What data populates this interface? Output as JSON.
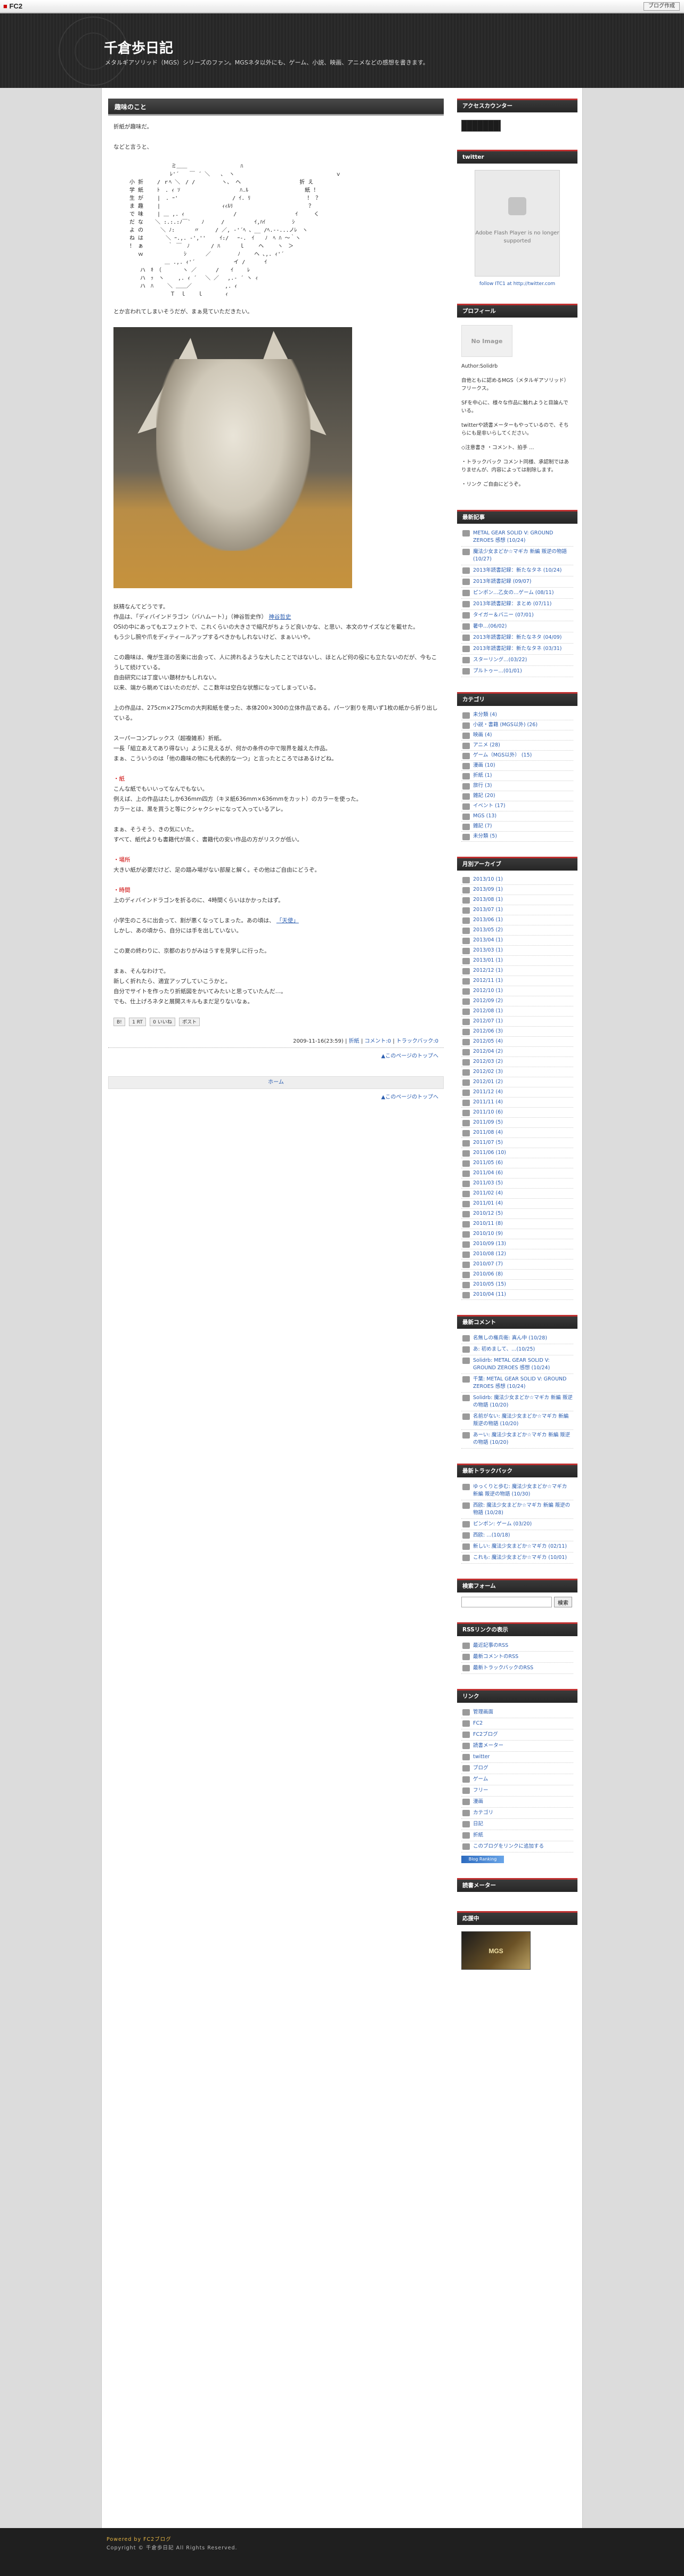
{
  "fc2bar": {
    "logo_mark": "FC2",
    "blog_button": "ブログ作成"
  },
  "header": {
    "title": "千倉歩日記",
    "description": "メタルギアソリッド（MGS）シリーズのファン。MGSネタ以外にも、ゲーム、小説、映画、アニメなどの感想を書きます。"
  },
  "entry": {
    "title": "趣味のこと",
    "p1": "折紙が趣味だ。",
    "p2": "などと言うと、",
    "aa": "                  ミ＿＿　　　　　　　　　　ﾊ\n　　　　　　　　　　 ﾚ'´　　￣ ´ ＼　　、 ヽ　　　　　　　　　　　　　　　　　　　ｖ\n　　　小 折 　　/ ｒﾍ ＼　/ /　　　　　ヽ、 ヘ　　　　　　　　　　　折 え\n　　　学 紙 　　ﾄ　. ｨ ｿ　 　　　　　　　　　 ﾊ.ﾙ　　　　　　　　　　 紙 ！\n　　　生 が 　　|　. ｰ' 　　　　　　　　　 / ｲ. ﾘ　　　　　　　　　　 ！ ？\n　　　ま 趣 　　|　　　　　　　　　　　 ｨｨﾙﾘ　 　　　　　　　　　　　　 ？\n　　　で 味 　　| ＿ ,. ｨ　　　　 　　　　 /　　　　　　　　　　　ｲ　　　く\n　　　だ な 　 ＼ :.:.:ﾉ￣`　　ﾉ 　　 /　　　　　 ｲ,ﾊｲ　　　　　ｼ\n　　　よ の 　　 ＼ ﾉ:　　　 〃　　　/ ／, -'´ﾍ 、__ /ﾍ.--...ノﾚ　ヽ\n　　　ね は 　　　 ＼ ｰ.,. -',''　　 ｲ:/　 ｰ-.　ｲ　　ﾉ　ﾍ ﾊ ～｀ヽ\n　　　！ ぁ　　　　 ｀ ￣　ﾉ　　　　/ ﾊ　　　 ｌ　　 ヘ　　 ヽ　＞\n　　　　 ｗ　　　　　　　 ｼ 　　　／　　　　　ﾉ　　 ヘ ､,. ｨ'´\n　　　　　　　　　 ＿ .,. ｨ'´ 　　　　　　 イ /　　　 ｲ\n　　　　　ハ　ｷ　（　　　　ヽ ／　　　 / 　 ｲ　　 ﾚ\n　　　　　ハ　ｯ　ヽ　　 ,. ｨ ´　 ＼ ／　 ,.- ´ ヽ ｨ\n　　　　　ハ　ﾊ　　 ＼ ＿＿／ 　　　　　 ,. ｨ\n　　　　　　　　　　 Ｔ　ｌ 　 ｌ 　　　 ｨ",
    "p3": "とか言われてしまいそうだが、まぁ見ていただきたい。",
    "p4": "妖精なんてどうです。",
    "p5": "作品は、「ディバインドラゴン（バハムート）」（神谷哲史作）",
    "p6": "OSIの中にあってもエフェクトで、これくらいの大きさで縮尺がちょうど良いかな、と思い、本文のサイズなどを載せた。",
    "p7": "もう少し腕や爪をディティールアップするべきかもしれないけど、まぁいいや。",
    "p8": "この趣味は、俺が生涯の苦楽に出会って、人に誇れるような大したことではないし、ほとんど何の役にも立たないのだが、今もこうして続けている。",
    "p9": "自由研究には丁度いい題材かもしれない。",
    "p10": "以来、端から眺めてはいたのだが、ここ数年は空白な状態になってしまっている。",
    "p11": "上の作品は、275cm×275cmの大判和紙を使った、本体200×300の立体作品である。パーツ割りを用いず1枚の紙から折り出している。",
    "p12": "スーパーコンプレックス（超複雑系）折紙。",
    "p13": "一長「組立あえてあり得ない」ように見えるが、何かの条件の中で限界を越えた作品。",
    "p14": "まぁ、こういうのは「他の趣味の物にも代表的な一つ」と言ったところではあるけどね。",
    "mark1": "・紙",
    "p15": "こんな紙でもいいってなんでもない。",
    "p16": "例えば、上の作品はたしか636mm四方（キヌ紙636mm×636mmをカット）のカラーを使った。",
    "p17": "カラーとは、黒を買うと等にクシャクシャになって入っているアレ。",
    "p18": "まぁ、そうそう、きの気にいた。",
    "p19": "すべて、紙代よりも書籍代が高く、書籍代の安い作品の方がリスクが低い。",
    "mark2": "・場所",
    "p20": "大きい紙が必要だけど、足の踏み場がない部屋と解く。その他はご自由にどうぞ。",
    "mark3": "・時間",
    "p21": "上のディバインドラゴンを折るのに、4時間くらいはかかったはず。",
    "p22": "小学生のころに出会って、割が悪くなってしまった。あの頃は、",
    "p23": "しかし、あの頃から、自分には手を出していない。",
    "p24": "この夏の終わりに、京都のおりがみはうすを見学しに行った。",
    "p25": "まぁ、そんなわけで。",
    "p26": "新しく折れたら、適宜アップしていこうかと。",
    "p27": "自分でサイトを作ったり折紙図をかいてみたいと思っていたんだ…。",
    "p28": "でも、仕上げろネタと展開スキルもまだ足りないなぁ。",
    "link1": "神谷哲史",
    "link2": "「天使」",
    "social": [
      "B!",
      "1 RT",
      "0 いいね",
      "ポスト"
    ],
    "footer_meta": "2009-11-16(23:59)",
    "footer_links": [
      "折紙",
      "コメント:0",
      "トラックバック:0"
    ],
    "pagetop": "▲このページのトップへ"
  },
  "pager": {
    "label": "ホーム",
    "pagetop": "▲このページのトップへ"
  },
  "sidebar": {
    "access": {
      "title": "アクセスカウンター"
    },
    "twitter": {
      "title": "twitter",
      "flash_msg": "Adobe Flash Player is no longer supported",
      "link": "follow ITC1 at http://twitter.com"
    },
    "profile": {
      "title": "プロフィール",
      "noimage": "No Image",
      "text1": "Author:Solidrb",
      "text2": "自他ともに認めるMGS（メタルギアソリッド）フリークス。",
      "text3": "SFを中心に、様々な作品に触れようと目論んでいる。",
      "text4": "twitterや読書メーターもやっているので、そちらにも是非いらしてください。",
      "text5": "◇注意書き ・コメント、拍手 …",
      "text6": "・トラックバック コメント同様、承認制ではありませんが、内容によっては削除します。",
      "text7": "・リンク ご自由にどうぞ。"
    },
    "recent_entries": {
      "title": "最新記事",
      "items": [
        "METAL GEAR SOLID V: GROUND ZEROES 感想 (10/24)",
        "魔法少女まどか☆マギカ 新編 叛逆の物語 (10/27)",
        "2013年読書記録：新たなタネ (10/24)",
        "2013年読書記録 (09/07)",
        "ピンポン…乙女の…ゲーム (08/11)",
        "2013年読書記録：まとめ (07/11)",
        "タイガー＆バニー (07/01)",
        "暑中…(06/02)",
        "2013年読書記録：新たなネタ (04/09)",
        "2013年読書記録：新たなタネ (03/31)",
        "スターリング…(03/22)",
        "プルトゥー…(01/01)"
      ]
    },
    "category": {
      "title": "カテゴリ",
      "items": [
        "未分類 (4)",
        "小説・書籍 (MGS以外) (26)",
        "映画 (4)",
        "アニメ (28)",
        "ゲーム（MGS以外） (15)",
        "漫画 (10)",
        "折紙 (1)",
        "旅行 (3)",
        "雑記 (20)",
        "イベント (17)",
        "MGS (13)",
        "雑記 (7)",
        "未分類 (5)"
      ]
    },
    "archive": {
      "title": "月別アーカイブ",
      "items": [
        "2013/10 (1)",
        "2013/09 (1)",
        "2013/08 (1)",
        "2013/07 (1)",
        "2013/06 (1)",
        "2013/05 (2)",
        "2013/04 (1)",
        "2013/03 (1)",
        "2013/01 (1)",
        "2012/12 (1)",
        "2012/11 (1)",
        "2012/10 (1)",
        "2012/09 (2)",
        "2012/08 (1)",
        "2012/07 (1)",
        "2012/06 (3)",
        "2012/05 (4)",
        "2012/04 (2)",
        "2012/03 (2)",
        "2012/02 (3)",
        "2012/01 (2)",
        "2011/12 (4)",
        "2011/11 (4)",
        "2011/10 (6)",
        "2011/09 (5)",
        "2011/08 (4)",
        "2011/07 (5)",
        "2011/06 (10)",
        "2011/05 (6)",
        "2011/04 (6)",
        "2011/03 (5)",
        "2011/02 (4)",
        "2011/01 (4)",
        "2010/12 (5)",
        "2010/11 (8)",
        "2010/10 (9)",
        "2010/09 (13)",
        "2010/08 (12)",
        "2010/07 (7)",
        "2010/06 (8)",
        "2010/05 (15)",
        "2010/04 (11)"
      ]
    },
    "recent_comments": {
      "title": "最新コメント",
      "items": [
        "名無しの権兵衛: 真ん中 (10/28)",
        "あ: 初めまして、…(10/25)",
        "Solidrb: METAL GEAR SOLID V: GROUND ZEROES 感想 (10/24)",
        "千葉: METAL GEAR SOLID V: GROUND ZEROES 感想 (10/24)",
        "Solidrb: 魔法少女まどか☆マギカ 新編 叛逆の物語 (10/20)",
        "名前がない: 魔法少女まどか☆マギカ 新編 叛逆の物語 (10/20)",
        "あーい: 魔法少女まどか☆マギカ 新編 叛逆の物語 (10/20)"
      ]
    },
    "recent_trackbacks": {
      "title": "最新トラックバック",
      "items": [
        "ゆっくりと歩む: 魔法少女まどか☆マギカ 新編 叛逆の物語 (10/30)",
        "西欧: 魔法少女まどか☆マギカ 新編 叛逆の物語 (10/28)",
        "ピンポン: ゲーム (03/20)",
        "西欧: …(10/18)",
        "新しい: 魔法少女まどか☆マギカ (02/11)",
        "これも: 魔法少女まどか☆マギカ (10/01)"
      ]
    },
    "search": {
      "title": "検索フォーム",
      "button": "検索"
    },
    "rss": {
      "title": "RSSリンクの表示",
      "items": [
        "最近記事のRSS",
        "最新コメントのRSS",
        "最新トラックバックのRSS"
      ]
    },
    "links": {
      "title": "リンク",
      "items": [
        "管理画面",
        "FC2",
        "FC2ブログ",
        "読書メーター",
        "twitter",
        "ブログ",
        "ゲーム",
        "フリー",
        "漫画",
        "カテゴリ",
        "日記",
        "折紙",
        "このブログをリンクに追加する"
      ],
      "banner": "Blog Ranking"
    },
    "bookmeter": {
      "title": "読書メーター"
    },
    "ouen": {
      "title": "応援中",
      "banner": "MGS"
    }
  },
  "footer": {
    "powered": "Powered by FC2ブログ",
    "copyright": "Copyright © 千倉歩日記 All Rights Reserved."
  }
}
